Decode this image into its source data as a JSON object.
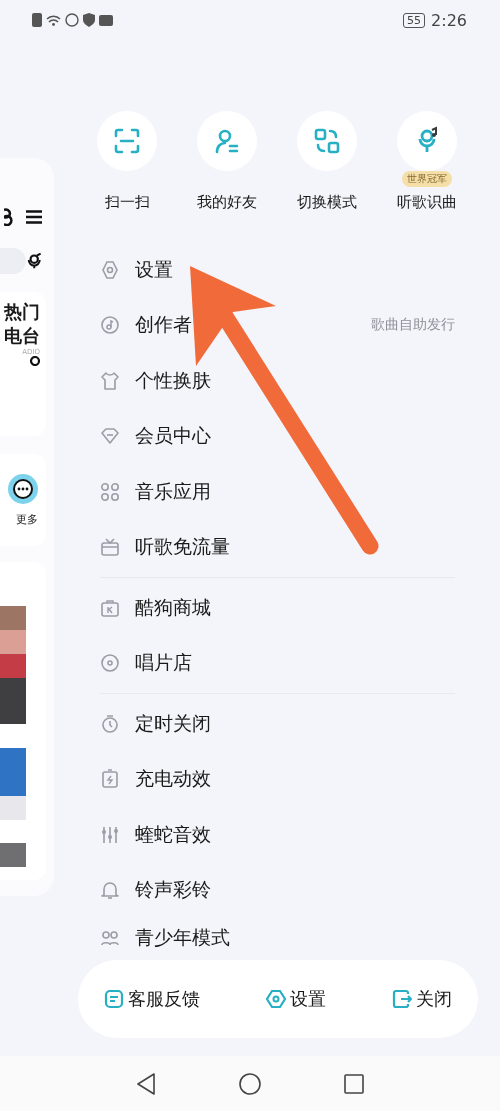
{
  "status_bar": {
    "battery": "55",
    "time": "2:26"
  },
  "side_page": {
    "title_lines": [
      "热门",
      "电台"
    ],
    "caption": "ADIO",
    "more": "更多"
  },
  "shortcuts": [
    {
      "label": "扫一扫"
    },
    {
      "label": "我的好友"
    },
    {
      "label": "切换模式"
    },
    {
      "label": "听歌识曲",
      "badge": "世界冠军"
    }
  ],
  "menu_groups": [
    [
      {
        "label": "设置"
      },
      {
        "label": "创作者",
        "hint": "歌曲自助发行"
      },
      {
        "label": "个性换肤"
      },
      {
        "label": "会员中心"
      },
      {
        "label": "音乐应用"
      },
      {
        "label": "听歌免流量"
      }
    ],
    [
      {
        "label": "酷狗商城"
      },
      {
        "label": "唱片店"
      }
    ],
    [
      {
        "label": "定时关闭"
      },
      {
        "label": "充电动效"
      },
      {
        "label": "蝰蛇音效"
      },
      {
        "label": "铃声彩铃"
      },
      {
        "label": "青少年模式"
      }
    ]
  ],
  "bottom_bar": [
    {
      "label": "客服反馈"
    },
    {
      "label": "设置"
    },
    {
      "label": "关闭"
    }
  ]
}
